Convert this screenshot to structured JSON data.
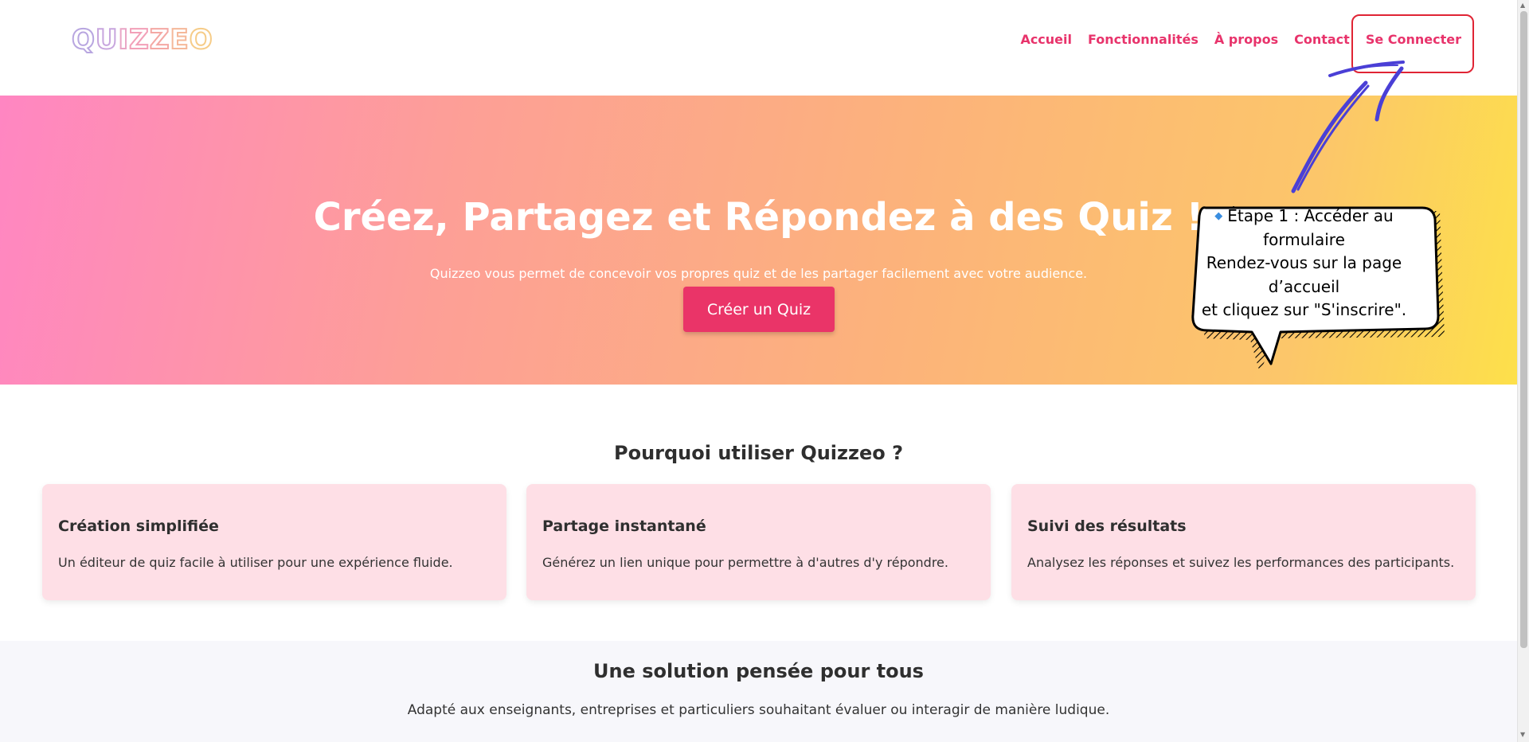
{
  "header": {
    "logo_letters": [
      "Q",
      "U",
      "I",
      "Z",
      "Z",
      "E",
      "O"
    ],
    "nav": [
      {
        "label": "Accueil"
      },
      {
        "label": "Fonctionnalités"
      },
      {
        "label": "À propos"
      },
      {
        "label": "Contact"
      },
      {
        "label": "Se Connecter"
      }
    ]
  },
  "hero": {
    "title": "Créez, Partagez et Répondez à des Quiz !",
    "subtitle": "Quizzeo vous permet de concevoir vos propres quiz et de les partager facilement avec votre audience.",
    "cta_label": "Créer un Quiz"
  },
  "annotation": {
    "diamond_icon": "small-blue-diamond-icon",
    "lines": [
      "Étape 1 : Accéder au",
      "formulaire",
      "Rendez-vous sur la page",
      "d’accueil",
      "et cliquez sur \"S'inscrire\"."
    ],
    "highlight_color": "#e02434",
    "arrow_color": "#4a3fd6"
  },
  "why": {
    "title": "Pourquoi utiliser Quizzeo ?",
    "cards": [
      {
        "title": "Création simplifiée",
        "desc": "Un éditeur de quiz facile à utiliser pour une expérience fluide."
      },
      {
        "title": "Partage instantané",
        "desc": "Générez un lien unique pour permettre à d'autres d'y répondre."
      },
      {
        "title": "Suivi des résultats",
        "desc": "Analysez les réponses et suivez les performances des participants."
      }
    ]
  },
  "solution": {
    "title": "Une solution pensée pour tous",
    "desc": "Adapté aux enseignants, entreprises et particuliers souhaitant évaluer ou interagir de manière ludique."
  },
  "colors": {
    "accent": "#e8336b",
    "button": "#ea3468",
    "card_bg": "#fedfe6",
    "hero_gradient_start": "#ff86c2",
    "hero_gradient_end": "#fde04a"
  }
}
